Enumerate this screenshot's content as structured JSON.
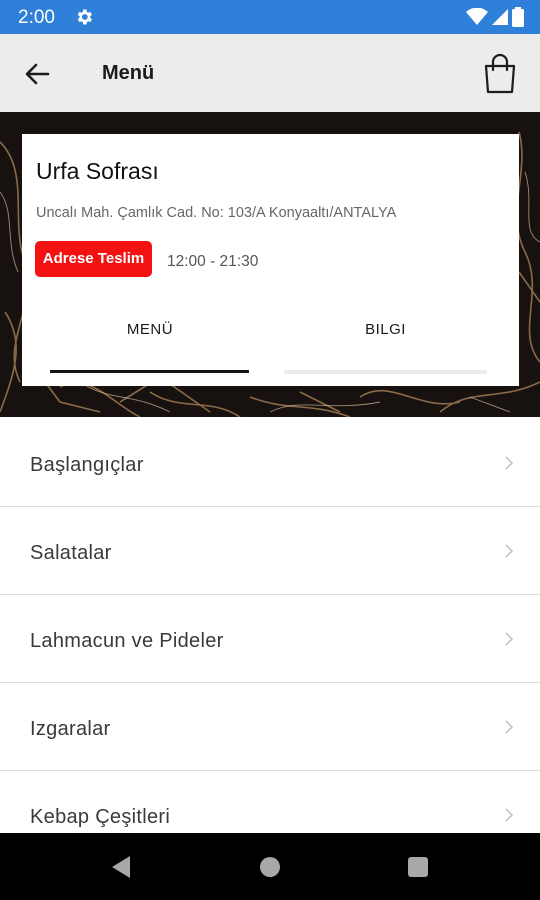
{
  "status_bar": {
    "time": "2:00"
  },
  "app_bar": {
    "title": "Menü"
  },
  "restaurant": {
    "name": "Urfa Sofrası",
    "address": "Uncalı Mah. Çamlık Cad. No: 103/A Konyaaltı/ANTALYA",
    "badge": "Adrese Teslim",
    "hours": "12:00 - 21:30"
  },
  "tabs": [
    {
      "label": "MENÜ",
      "active": true
    },
    {
      "label": "BILGI",
      "active": false
    }
  ],
  "categories": [
    {
      "label": "Başlangıçlar"
    },
    {
      "label": "Salatalar"
    },
    {
      "label": "Lahmacun ve Pideler"
    },
    {
      "label": "Izgaralar"
    },
    {
      "label": "Kebap Çeşitleri"
    }
  ],
  "colors": {
    "status_bar": "#2f80d9",
    "badge": "#f21212",
    "app_bar": "#ececec"
  }
}
